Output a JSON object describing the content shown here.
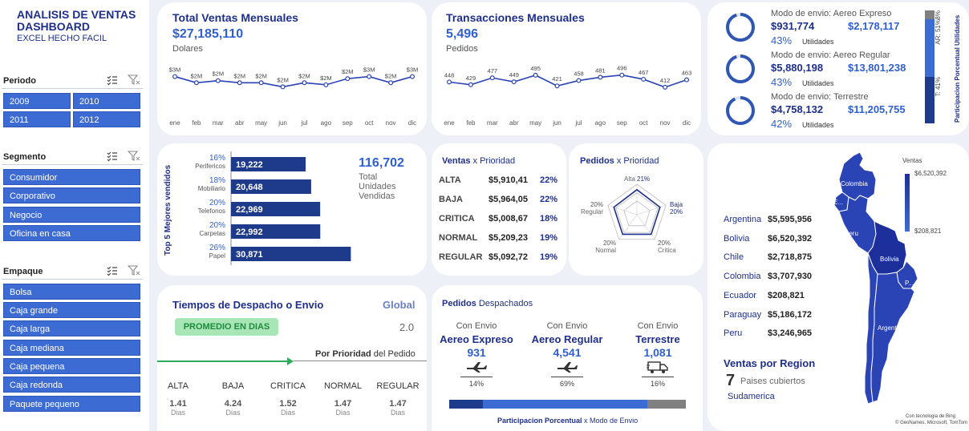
{
  "header": {
    "title": "ANALISIS DE VENTAS DASHBOARD",
    "subtitle": "EXCEL HECHO FACIL"
  },
  "filters": {
    "periodo": {
      "title": "Periodo",
      "items": [
        "2009",
        "2010",
        "2011",
        "2012"
      ]
    },
    "segmento": {
      "title": "Segmento",
      "items": [
        "Consumidor",
        "Corporativo",
        "Negocio",
        "Oficina en casa"
      ]
    },
    "empaque": {
      "title": "Empaque",
      "items": [
        "Bolsa",
        "Caja grande",
        "Caja larga",
        "Caja mediana",
        "Caja pequena",
        "Caja redonda",
        "Paquete pequeno"
      ]
    }
  },
  "ventas_mensuales": {
    "title": "Total Ventas Mensuales",
    "value": "$27,185,110",
    "unit": "Dolares"
  },
  "transacciones": {
    "title": "Transacciones Mensuales",
    "value": "5,496",
    "unit": "Pedidos"
  },
  "envio_modes": {
    "prefix": "Modo de envio: ",
    "util_label": "Utilidades",
    "items": [
      {
        "name": "Aereo Expreso",
        "ventas": "$931,774",
        "utilidad": "$2,178,117",
        "pct": "43%",
        "fill": 0.95
      },
      {
        "name": "Aereo Regular",
        "ventas": "$5,880,198",
        "utilidad": "$13,801,238",
        "pct": "43%",
        "fill": 0.95
      },
      {
        "name": "Terrestre",
        "ventas": "$4,758,132",
        "utilidad": "$11,205,755",
        "pct": "42%",
        "fill": 0.93
      }
    ],
    "side_bar": {
      "title": "Participacion Porcentual Utilidades",
      "segments": [
        {
          "label": "AE: 8%",
          "value": 8,
          "color": "#808080"
        },
        {
          "label": "AR: 51%",
          "value": 51,
          "color": "#3d6bd4"
        },
        {
          "label": "T: 41%",
          "value": 41,
          "color": "#1e3a8a"
        }
      ]
    }
  },
  "top5": {
    "axis_title": "Top 5 Mejores vendidos",
    "total_value": "116,702",
    "total_label": "Total Unidades Vendidas"
  },
  "prioridad": {
    "title_bold": "Ventas",
    "title_rest": " x Prioridad",
    "rows": [
      {
        "name": "ALTA",
        "value": "$5,910,41",
        "pct": "22%"
      },
      {
        "name": "BAJA",
        "value": "$5,964,05",
        "pct": "22%"
      },
      {
        "name": "CRITICA",
        "value": "$5,008,67",
        "pct": "18%"
      },
      {
        "name": "NORMAL",
        "value": "$5,209,23",
        "pct": "19%"
      },
      {
        "name": "REGULAR",
        "value": "$5,092,72",
        "pct": "19%"
      }
    ]
  },
  "pedidos_prioridad": {
    "title_bold": "Pedidos",
    "title_rest": " x Prioridad"
  },
  "despacho": {
    "title": "Tiempos de Despacho o Envio",
    "global_label": "Global",
    "badge": "PROMEDIO EN DIAS",
    "global_value": "2.0",
    "sub_bold": "Por Prioridad",
    "sub_rest": " del Pedido",
    "unit": "Dias",
    "items": [
      {
        "name": "ALTA",
        "value": "1.41"
      },
      {
        "name": "BAJA",
        "value": "4.24"
      },
      {
        "name": "CRITICA",
        "value": "1.52"
      },
      {
        "name": "NORMAL",
        "value": "1.47"
      },
      {
        "name": "REGULAR",
        "value": "1.47"
      }
    ]
  },
  "pedidos_despachados": {
    "title_bold": "Pedidos",
    "title_rest": " Despachados",
    "con_envio": "Con Envio",
    "items": [
      {
        "name": "Aereo Expreso",
        "value": "931",
        "pct": "14%"
      },
      {
        "name": "Aereo Regular",
        "value": "4,541",
        "pct": "69%"
      },
      {
        "name": "Terrestre",
        "value": "1,081",
        "pct": "16%"
      }
    ],
    "footer_bold": "Participacion Porcentual",
    "footer_rest": " x Modo de Envio"
  },
  "region": {
    "countries": [
      {
        "name": "Argentina",
        "value": "$5,595,956"
      },
      {
        "name": "Bolivia",
        "value": "$6,520,392"
      },
      {
        "name": "Chile",
        "value": "$2,718,875"
      },
      {
        "name": "Colombia",
        "value": "$3,707,930"
      },
      {
        "name": "Ecuador",
        "value": "$208,821"
      },
      {
        "name": "Paraguay",
        "value": "$5,186,172"
      },
      {
        "name": "Peru",
        "value": "$3,246,965"
      }
    ],
    "title": "Ventas por Region",
    "count": "7",
    "count_label": "Paises cubiertos",
    "area": "Sudamerica",
    "legend_title": "Ventas",
    "legend_max": "$6,520,392",
    "legend_min": "$208,821",
    "map_labels": [
      "Colombia",
      "E...",
      "Peru",
      "Bolivia",
      "P...",
      "Argentina"
    ],
    "credit1": "Con tecnologia de Bing",
    "credit2": "© GeoNames, Microsoft, TomTom"
  },
  "chart_data": [
    {
      "type": "line",
      "title": "Total Ventas Mensuales",
      "categories": [
        "ene",
        "feb",
        "mar",
        "abr",
        "may",
        "jun",
        "jul",
        "ago",
        "sep",
        "oct",
        "nov",
        "dic"
      ],
      "values": [
        2.6,
        2.3,
        2.4,
        2.3,
        2.3,
        2.1,
        2.3,
        2.2,
        2.5,
        2.6,
        2.3,
        2.6
      ],
      "labels": [
        "$3M",
        "$2M",
        "$2M",
        "$2M",
        "$2M",
        "$2M",
        "$2M",
        "$2M",
        "$2M",
        "$3M",
        "$2M",
        "$3M"
      ],
      "color": "#2a43b5"
    },
    {
      "type": "line",
      "title": "Transacciones Mensuales",
      "categories": [
        "ene",
        "feb",
        "mar",
        "abr",
        "may",
        "jun",
        "jul",
        "ago",
        "sep",
        "oct",
        "nov",
        "dic"
      ],
      "values": [
        448,
        429,
        477,
        449,
        495,
        421,
        458,
        481,
        496,
        467,
        412,
        463
      ],
      "color": "#2a43b5"
    },
    {
      "type": "bar",
      "title": "Top 5 Mejores vendidos",
      "categories": [
        "Perifericos",
        "Mobiliario",
        "Telefonos",
        "Carpetas",
        "Papel"
      ],
      "pcts": [
        "16%",
        "18%",
        "20%",
        "20%",
        "26%"
      ],
      "values": [
        19222,
        20648,
        22969,
        22992,
        30871
      ],
      "labels": [
        "19,222",
        "20,648",
        "22,969",
        "22,992",
        "30,871"
      ],
      "color": "#1e3a8a"
    },
    {
      "type": "radar",
      "title": "Pedidos x Prioridad",
      "categories": [
        "Alta",
        "Baja",
        "Critica",
        "Normal",
        "Regular"
      ],
      "values": [
        21,
        20,
        20,
        20,
        20
      ]
    },
    {
      "type": "bar",
      "title": "Participacion Porcentual x Modo de Envio",
      "categories": [
        "Aereo Expreso",
        "Aereo Regular",
        "Terrestre"
      ],
      "values": [
        14,
        69,
        16
      ],
      "colors": [
        "#1e3a8a",
        "#3d6bd4",
        "#808080"
      ]
    }
  ]
}
